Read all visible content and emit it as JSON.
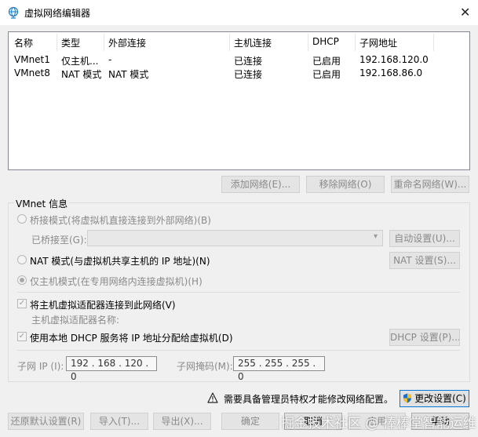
{
  "window": {
    "title": "虚拟网络编辑器",
    "close_glyph": "✕"
  },
  "networks": {
    "columns": [
      "名称",
      "类型",
      "外部连接",
      "主机连接",
      "DHCP",
      "子网地址"
    ],
    "rows": [
      [
        "VMnet1",
        "仅主机...",
        "-",
        "已连接",
        "已启用",
        "192.168.120.0"
      ],
      [
        "VMnet8",
        "NAT 模式",
        "NAT 模式",
        "已连接",
        "已启用",
        "192.168.86.0"
      ]
    ]
  },
  "list_buttons": {
    "add": "添加网络(E)...",
    "remove": "移除网络(O)",
    "rename": "重命名网络(W)..."
  },
  "vmnet_info": {
    "group_label": "VMnet 信息",
    "bridged_label": "桥接模式(将虚拟机直接连接到外部网络)(B)",
    "bridged_to_label": "已桥接至(G):",
    "bridged_to_value": "",
    "auto_settings": "自动设置(U)...",
    "nat_label": "NAT 模式(与虚拟机共享主机的 IP 地址)(N)",
    "nat_settings": "NAT 设置(S)...",
    "hostonly_label": "仅主机模式(在专用网络内连接虚拟机)(H)",
    "connect_adapter_label": "将主机虚拟适配器连接到此网络(V)",
    "adapter_name_label": "主机虚拟适配器名称:",
    "dhcp_label": "使用本地 DHCP 服务将 IP 地址分配给虚拟机(D)",
    "dhcp_settings": "DHCP 设置(P)...",
    "subnet_ip_label": "子网 IP (I):",
    "subnet_ip": "192 . 168 . 120 .  0",
    "subnet_mask_label": "子网掩码(M):",
    "subnet_mask": "255 . 255 . 255 .  0"
  },
  "admin_notice": {
    "text": "需要具备管理员特权才能修改网络配置。",
    "change_button": "更改设置(C)"
  },
  "footer": {
    "restore": "还原默认设置(R)",
    "import": "导入(T)...",
    "export": "导出(X)...",
    "ok": "确定",
    "cancel": "取消",
    "apply": "应用",
    "help": "帮助"
  },
  "watermark": "掘金技术社区 @ 棒棒堂智能运维"
}
